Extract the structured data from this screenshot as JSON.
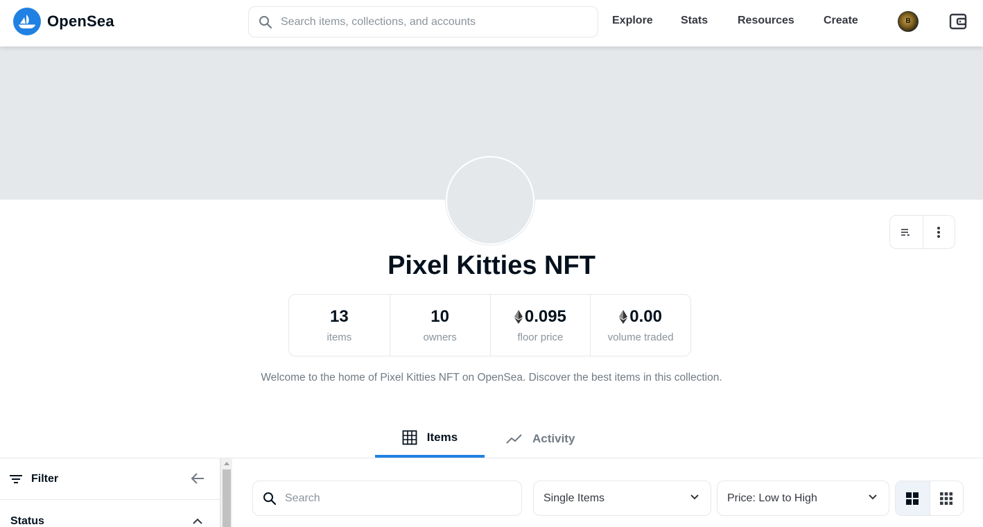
{
  "header": {
    "logo_text": "OpenSea",
    "search_placeholder": "Search items, collections, and accounts",
    "nav": [
      "Explore",
      "Stats",
      "Resources",
      "Create"
    ],
    "avatar_initial": "B"
  },
  "collection": {
    "name": "Pixel Kitties NFT",
    "description": "Welcome to the home of Pixel Kitties NFT on OpenSea. Discover the best items in this collection.",
    "stats": [
      {
        "value": "13",
        "label": "items",
        "eth": false
      },
      {
        "value": "10",
        "label": "owners",
        "eth": false
      },
      {
        "value": "0.095",
        "label": "floor price",
        "eth": true
      },
      {
        "value": "0.00",
        "label": "volume traded",
        "eth": true
      }
    ]
  },
  "tabs": {
    "items_label": "Items",
    "activity_label": "Activity",
    "active": "Items"
  },
  "sidebar": {
    "filter_label": "Filter",
    "status_label": "Status"
  },
  "toolbar": {
    "search_placeholder": "Search",
    "type_selected": "Single Items",
    "sort_selected": "Price: Low to High"
  },
  "colors": {
    "brand": "#2081e2",
    "text": "#04111d",
    "muted": "#8a939b",
    "border": "#e5e8eb"
  }
}
